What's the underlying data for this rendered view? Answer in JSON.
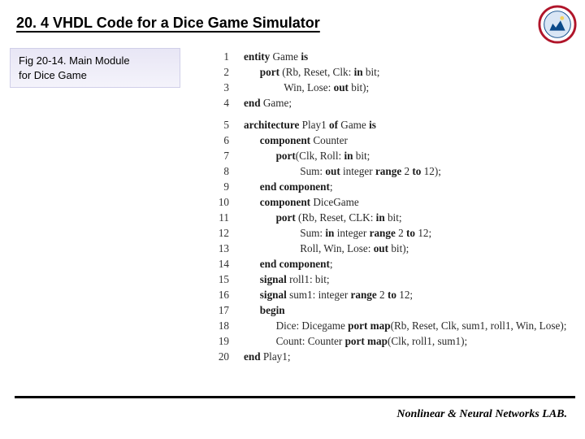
{
  "title": "20. 4 VHDL Code for a Dice Game Simulator",
  "caption": {
    "line1": "Fig 20-14. Main Module",
    "line2": "for Dice Game"
  },
  "code": [
    {
      "n": 1,
      "indent": 0,
      "tokens": [
        [
          "b",
          "entity"
        ],
        [
          " ",
          " Game "
        ],
        [
          "b",
          "is"
        ]
      ]
    },
    {
      "n": 2,
      "indent": 2,
      "tokens": [
        [
          "b",
          "port"
        ],
        [
          " ",
          " (Rb, Reset, Clk: "
        ],
        [
          "b",
          "in"
        ],
        [
          " ",
          " bit;"
        ]
      ]
    },
    {
      "n": 3,
      "indent": 5,
      "tokens": [
        [
          " ",
          "Win, Lose: "
        ],
        [
          "b",
          "out"
        ],
        [
          " ",
          " bit);"
        ]
      ]
    },
    {
      "n": 4,
      "indent": 0,
      "tokens": [
        [
          "b",
          "end"
        ],
        [
          " ",
          " Game;"
        ]
      ]
    },
    {
      "n": 5,
      "indent": 0,
      "blank_before": true,
      "tokens": [
        [
          "b",
          "architecture"
        ],
        [
          " ",
          " Play1 "
        ],
        [
          "b",
          "of"
        ],
        [
          " ",
          " Game "
        ],
        [
          "b",
          "is"
        ]
      ]
    },
    {
      "n": 6,
      "indent": 2,
      "tokens": [
        [
          "b",
          "component"
        ],
        [
          " ",
          " Counter"
        ]
      ]
    },
    {
      "n": 7,
      "indent": 4,
      "tokens": [
        [
          "b",
          "port"
        ],
        [
          " ",
          "(Clk, Roll: "
        ],
        [
          "b",
          "in"
        ],
        [
          " ",
          " bit;"
        ]
      ]
    },
    {
      "n": 8,
      "indent": 7,
      "tokens": [
        [
          " ",
          "Sum: "
        ],
        [
          "b",
          "out"
        ],
        [
          " ",
          " integer "
        ],
        [
          "b",
          "range"
        ],
        [
          " ",
          " 2 "
        ],
        [
          "b",
          "to"
        ],
        [
          " ",
          " 12);"
        ]
      ]
    },
    {
      "n": 9,
      "indent": 2,
      "tokens": [
        [
          "b",
          "end component"
        ],
        [
          " ",
          ";"
        ]
      ]
    },
    {
      "n": 10,
      "indent": 2,
      "tokens": [
        [
          "b",
          "component"
        ],
        [
          " ",
          " DiceGame"
        ]
      ]
    },
    {
      "n": 11,
      "indent": 4,
      "tokens": [
        [
          "b",
          "port"
        ],
        [
          " ",
          " (Rb, Reset, CLK: "
        ],
        [
          "b",
          "in"
        ],
        [
          " ",
          " bit;"
        ]
      ]
    },
    {
      "n": 12,
      "indent": 7,
      "tokens": [
        [
          " ",
          "Sum: "
        ],
        [
          "b",
          "in"
        ],
        [
          " ",
          " integer "
        ],
        [
          "b",
          "range"
        ],
        [
          " ",
          " 2 "
        ],
        [
          "b",
          "to"
        ],
        [
          " ",
          " 12;"
        ]
      ]
    },
    {
      "n": 13,
      "indent": 7,
      "tokens": [
        [
          " ",
          "Roll, Win, Lose: "
        ],
        [
          "b",
          "out"
        ],
        [
          " ",
          " bit);"
        ]
      ]
    },
    {
      "n": 14,
      "indent": 2,
      "tokens": [
        [
          "b",
          "end component"
        ],
        [
          " ",
          ";"
        ]
      ]
    },
    {
      "n": 15,
      "indent": 2,
      "tokens": [
        [
          "b",
          "signal"
        ],
        [
          " ",
          " roll1: bit;"
        ]
      ]
    },
    {
      "n": 16,
      "indent": 2,
      "tokens": [
        [
          "b",
          "signal"
        ],
        [
          " ",
          " sum1: integer "
        ],
        [
          "b",
          "range"
        ],
        [
          " ",
          " 2 "
        ],
        [
          "b",
          "to"
        ],
        [
          " ",
          " 12;"
        ]
      ]
    },
    {
      "n": 17,
      "indent": 2,
      "tokens": [
        [
          "b",
          "begin"
        ]
      ]
    },
    {
      "n": 18,
      "indent": 4,
      "tokens": [
        [
          " ",
          "Dice: Dicegame "
        ],
        [
          "b",
          "port map"
        ],
        [
          " ",
          "(Rb, Reset, Clk, sum1, roll1, Win, Lose);"
        ]
      ]
    },
    {
      "n": 19,
      "indent": 4,
      "tokens": [
        [
          " ",
          "Count: Counter "
        ],
        [
          "b",
          "port map"
        ],
        [
          " ",
          "(Clk, roll1, sum1);"
        ]
      ]
    },
    {
      "n": 20,
      "indent": 0,
      "tokens": [
        [
          "b",
          "end"
        ],
        [
          " ",
          " Play1;"
        ]
      ]
    }
  ],
  "footer": "Nonlinear & Neural Networks LAB.",
  "colors": {
    "logo_ring": "#b0152a",
    "logo_inner": "#0b4a8a"
  }
}
